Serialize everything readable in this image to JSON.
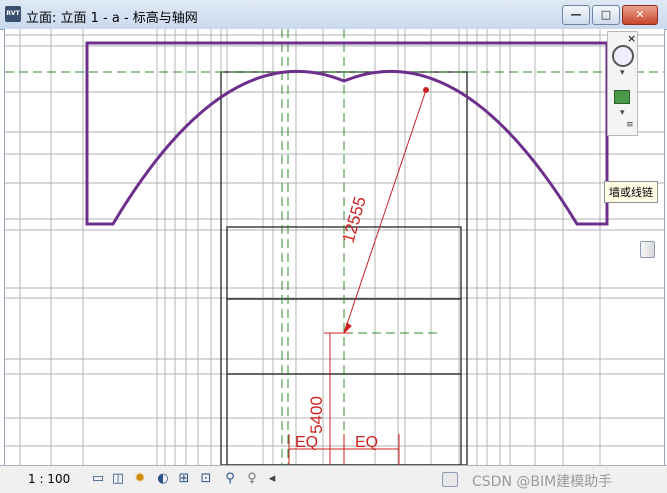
{
  "window": {
    "title": "立面: 立面 1 - a - 标高与轴网",
    "app_icon_label": "RVT",
    "buttons": {
      "minimize": "▭",
      "restore": "▫",
      "close": "✕"
    }
  },
  "drawing": {
    "dimensions": {
      "radius": "12555",
      "height": "5400",
      "eq_left": "EQ",
      "eq_right": "EQ"
    },
    "colors": {
      "arch": "#6e2f8c",
      "dimension": "#cc2222",
      "grid_dashed": "#2e8b2e",
      "lines": "#9a9a9a",
      "wall": "#333333"
    }
  },
  "navigation_bar": {
    "close": "×",
    "zoom_icon": "zoom-icon",
    "view_icon": "view-cube-icon"
  },
  "tooltip": {
    "text": "墙或线链"
  },
  "status_bar": {
    "scale": "1 : 100",
    "icons": [
      "detail-level-icon",
      "visual-style-icon",
      "sun-path-icon",
      "shadows-icon",
      "crop-view-icon",
      "show-crop-icon",
      "temporary-hide-icon",
      "reveal-hidden-icon",
      "design-option-icon"
    ]
  },
  "watermark": "CSDN @BIM建模助手"
}
